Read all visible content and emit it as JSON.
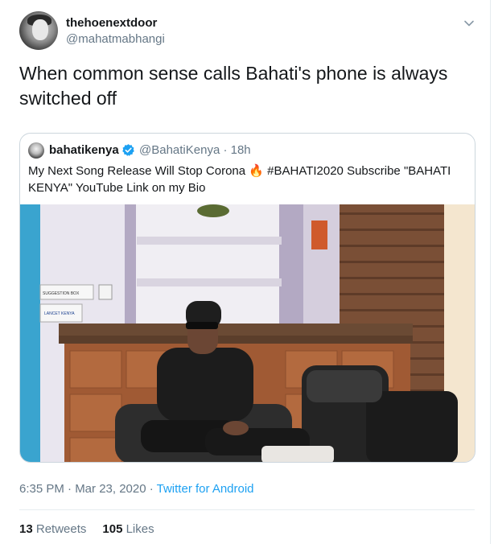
{
  "author": {
    "display_name": "thehoenextdoor",
    "handle": "@mahatmabhangi"
  },
  "tweet_text": "When common sense calls Bahati's phone is always switched off",
  "quoted_tweet": {
    "display_name": "bahatikenya",
    "verified": true,
    "handle_time": "@BahatiKenya · 18h",
    "text": "My Next Song Release Will Stop Corona 🔥 #BAHATI2020 Subscribe \"BAHATI KENYA\" YouTube Link on my Bio",
    "photo_signs": {
      "suggestion": "SUGGESTION BOX",
      "brand": "LANCET KENYA"
    }
  },
  "meta": {
    "time_date": "6:35 PM · Mar 23, 2020 · ",
    "source": "Twitter for Android"
  },
  "stats": {
    "retweets_count": "13",
    "retweets_label": "Retweets",
    "likes_count": "105",
    "likes_label": "Likes"
  },
  "colors": {
    "link": "#1da1f2",
    "secondary_text": "#657786",
    "border": "#ccd6dd"
  },
  "icons": {
    "caret": "chevron-down-icon",
    "verified": "verified-badge-icon"
  }
}
